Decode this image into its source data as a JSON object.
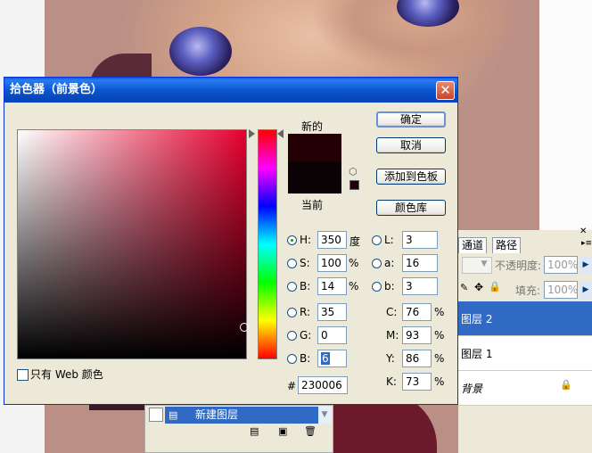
{
  "dialog": {
    "title": "拾色器（前景色）",
    "close_label": "✕",
    "label_new": "新的",
    "label_current": "当前",
    "buttons": {
      "ok": "确定",
      "cancel": "取消",
      "add_swatch": "添加到色板",
      "library": "颜色库"
    },
    "web_only_label": "只有 Web 颜色",
    "web_only_checked": false,
    "hsb": [
      {
        "label": "H:",
        "value": "350",
        "unit": "度",
        "selected": true
      },
      {
        "label": "S:",
        "value": "100",
        "unit": "%",
        "selected": false
      },
      {
        "label": "B:",
        "value": "14",
        "unit": "%",
        "selected": false
      }
    ],
    "rgb": [
      {
        "label": "R:",
        "value": "35"
      },
      {
        "label": "G:",
        "value": "0"
      },
      {
        "label": "B:",
        "value": "6"
      }
    ],
    "lab": [
      {
        "label": "L:",
        "value": "3"
      },
      {
        "label": "a:",
        "value": "16"
      },
      {
        "label": "b:",
        "value": "3"
      }
    ],
    "cmyk": [
      {
        "label": "C:",
        "value": "76",
        "unit": "%"
      },
      {
        "label": "M:",
        "value": "93",
        "unit": "%"
      },
      {
        "label": "Y:",
        "value": "86",
        "unit": "%"
      },
      {
        "label": "K:",
        "value": "73",
        "unit": "%"
      }
    ],
    "hex_label": "#",
    "hex_value": "230006",
    "colors": {
      "new": "#230006",
      "current": "#0a0204",
      "hue": "#e6002e"
    }
  },
  "layers_panel": {
    "tabs": [
      "通道",
      "路径"
    ],
    "opacity_label": "不透明度:",
    "opacity_value": "100%",
    "fill_label": "填充:",
    "fill_value": "100%",
    "layers": [
      {
        "name": "图层 2",
        "selected": true
      },
      {
        "name": "图层 1",
        "selected": false
      },
      {
        "name": "背景",
        "selected": false,
        "locked": true
      }
    ]
  },
  "bottom_panel": {
    "item_label": "新建图层"
  }
}
